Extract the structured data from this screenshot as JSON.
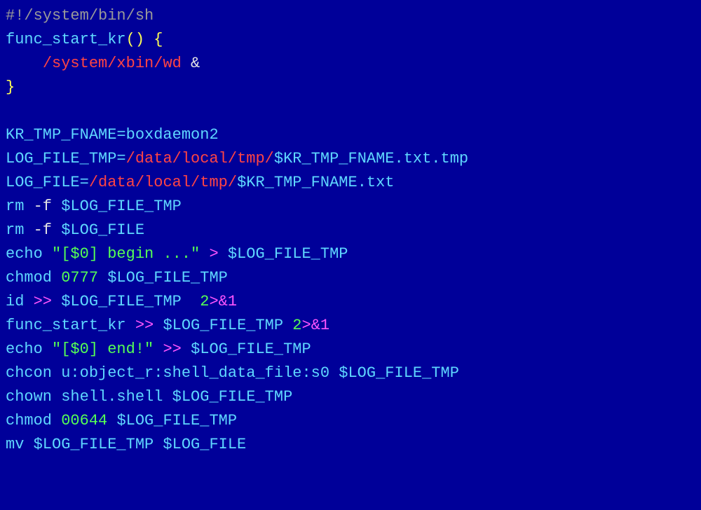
{
  "tokens": [
    {
      "id": "t0",
      "cls": "c-gray",
      "text": "#!/system/bin/sh"
    },
    {
      "id": "t1",
      "cls": "c-cyan",
      "text": "func_start_kr"
    },
    {
      "id": "t2",
      "cls": "c-yellow",
      "text": "() {"
    },
    {
      "id": "t3",
      "cls": "c-red",
      "text": "/system/xbin/wd"
    },
    {
      "id": "t4",
      "cls": "c-white",
      "text": " &"
    },
    {
      "id": "t5",
      "cls": "c-yellow",
      "text": "}"
    },
    {
      "id": "t6",
      "cls": "c-cyan",
      "text": "KR_TMP_FNAME=boxdaemon2"
    },
    {
      "id": "t7",
      "cls": "c-cyan",
      "text": "LOG_FILE_TMP="
    },
    {
      "id": "t8",
      "cls": "c-red",
      "text": "/data/local/tmp/"
    },
    {
      "id": "t9",
      "cls": "c-cyan",
      "text": "$KR_TMP_FNAME.txt.tmp"
    },
    {
      "id": "t10",
      "cls": "c-cyan",
      "text": "LOG_FILE="
    },
    {
      "id": "t11",
      "cls": "c-red",
      "text": "/data/local/tmp/"
    },
    {
      "id": "t12",
      "cls": "c-cyan",
      "text": "$KR_TMP_FNAME.txt"
    },
    {
      "id": "t13",
      "cls": "c-cyan",
      "text": "rm"
    },
    {
      "id": "t14",
      "cls": "c-white",
      "text": " -f "
    },
    {
      "id": "t15",
      "cls": "c-cyan",
      "text": "$LOG_FILE_TMP"
    },
    {
      "id": "t16",
      "cls": "c-cyan",
      "text": "rm"
    },
    {
      "id": "t17",
      "cls": "c-white",
      "text": " -f "
    },
    {
      "id": "t18",
      "cls": "c-cyan",
      "text": "$LOG_FILE"
    },
    {
      "id": "t19",
      "cls": "c-cyan",
      "text": "echo"
    },
    {
      "id": "t20",
      "cls": "c-white",
      "text": " "
    },
    {
      "id": "t21",
      "cls": "c-green",
      "text": "\"[$0] begin ...\""
    },
    {
      "id": "t22",
      "cls": "c-white",
      "text": " "
    },
    {
      "id": "t23",
      "cls": "c-magenta",
      "text": ">"
    },
    {
      "id": "t24",
      "cls": "c-white",
      "text": " "
    },
    {
      "id": "t25",
      "cls": "c-cyan",
      "text": "$LOG_FILE_TMP"
    },
    {
      "id": "t26",
      "cls": "c-cyan",
      "text": "chmod"
    },
    {
      "id": "t27",
      "cls": "c-white",
      "text": " "
    },
    {
      "id": "t28",
      "cls": "c-green",
      "text": "0777"
    },
    {
      "id": "t29",
      "cls": "c-white",
      "text": " "
    },
    {
      "id": "t30",
      "cls": "c-cyan",
      "text": "$LOG_FILE_TMP"
    },
    {
      "id": "t31",
      "cls": "c-cyan",
      "text": "id"
    },
    {
      "id": "t32",
      "cls": "c-white",
      "text": " "
    },
    {
      "id": "t33",
      "cls": "c-magenta",
      "text": ">>"
    },
    {
      "id": "t34",
      "cls": "c-white",
      "text": " "
    },
    {
      "id": "t35",
      "cls": "c-cyan",
      "text": "$LOG_FILE_TMP"
    },
    {
      "id": "t36",
      "cls": "c-white",
      "text": "  "
    },
    {
      "id": "t37",
      "cls": "c-green",
      "text": "2"
    },
    {
      "id": "t38",
      "cls": "c-magenta",
      "text": ">&1"
    },
    {
      "id": "t39",
      "cls": "c-cyan",
      "text": "func_start_kr"
    },
    {
      "id": "t40",
      "cls": "c-white",
      "text": " "
    },
    {
      "id": "t41",
      "cls": "c-magenta",
      "text": ">>"
    },
    {
      "id": "t42",
      "cls": "c-white",
      "text": " "
    },
    {
      "id": "t43",
      "cls": "c-cyan",
      "text": "$LOG_FILE_TMP"
    },
    {
      "id": "t44",
      "cls": "c-white",
      "text": " "
    },
    {
      "id": "t45",
      "cls": "c-green",
      "text": "2"
    },
    {
      "id": "t46",
      "cls": "c-magenta",
      "text": ">&1"
    },
    {
      "id": "t47",
      "cls": "c-cyan",
      "text": "echo"
    },
    {
      "id": "t48",
      "cls": "c-white",
      "text": " "
    },
    {
      "id": "t49",
      "cls": "c-green",
      "text": "\"[$0] end!\""
    },
    {
      "id": "t50",
      "cls": "c-white",
      "text": " "
    },
    {
      "id": "t51",
      "cls": "c-magenta",
      "text": ">>"
    },
    {
      "id": "t52",
      "cls": "c-white",
      "text": " "
    },
    {
      "id": "t53",
      "cls": "c-cyan",
      "text": "$LOG_FILE_TMP"
    },
    {
      "id": "t54",
      "cls": "c-cyan",
      "text": "chcon u:object_r:shell_data_file:s0 $LOG_FILE_TMP"
    },
    {
      "id": "t55",
      "cls": "c-cyan",
      "text": "chown shell.shell $LOG_FILE_TMP"
    },
    {
      "id": "t56",
      "cls": "c-cyan",
      "text": "chmod"
    },
    {
      "id": "t57",
      "cls": "c-white",
      "text": " "
    },
    {
      "id": "t58",
      "cls": "c-green",
      "text": "00644"
    },
    {
      "id": "t59",
      "cls": "c-white",
      "text": " "
    },
    {
      "id": "t60",
      "cls": "c-cyan",
      "text": "$LOG_FILE_TMP"
    },
    {
      "id": "t61",
      "cls": "c-cyan",
      "text": "mv $LOG_FILE_TMP $LOG_FILE"
    }
  ]
}
